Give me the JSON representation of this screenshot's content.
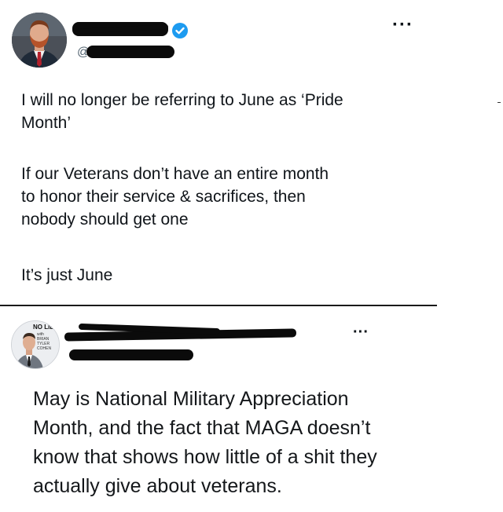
{
  "post1": {
    "handle_prefix": "@",
    "more_label": "···",
    "paragraphs": [
      "I will no longer be referring to June as ‘Pride\nMonth’",
      "If our Veterans don’t have an entire month\nto honor their service & sacrifices, then\nnobody should get one",
      "It’s just June"
    ]
  },
  "post2": {
    "avatar_badge": "NO LIE",
    "avatar_badge_sub": "with BRIAN TYLER COHEN",
    "more_label": "···",
    "body": "May is National Military Appreciation\nMonth, and the fact that MAGA doesn’t\nknow that shows how little of a shit they\nactually give about veterans."
  },
  "colors": {
    "verified_badge": "#1d9bf0",
    "redaction": "#0b0b0b",
    "text": "#0f1419"
  }
}
